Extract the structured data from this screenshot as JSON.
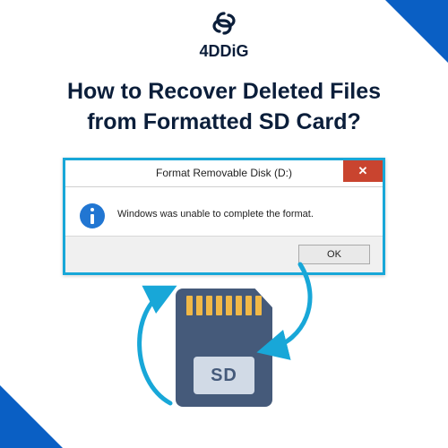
{
  "brand": {
    "name": "4DDiG"
  },
  "headline": {
    "line1": "How to Recover Deleted Files",
    "line2": "from Formatted SD Card?"
  },
  "dialog": {
    "title": "Format Removable Disk (D:)",
    "close": "✕",
    "message": "Windows was unable to complete the format.",
    "ok": "OK"
  },
  "sdcard": {
    "label": "SD"
  },
  "colors": {
    "accent": "#0a5fc4",
    "arrow": "#18a7d8",
    "sd": "#455a7a"
  }
}
